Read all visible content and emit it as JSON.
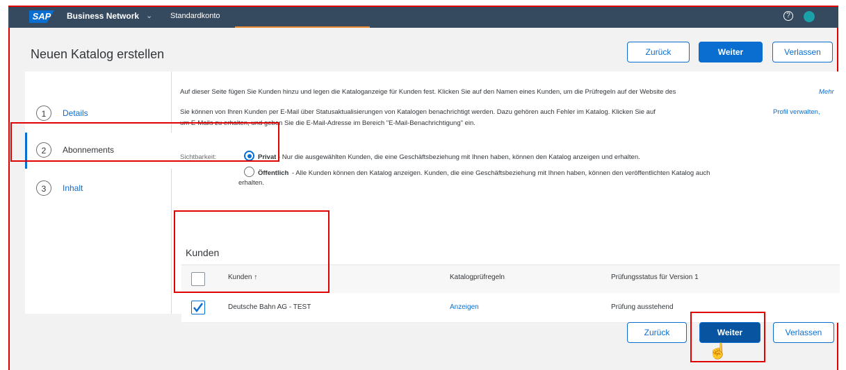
{
  "shell": {
    "logo": "SAP",
    "product": "Business Network",
    "account": "Standardkonto",
    "help_glyph": "?"
  },
  "header": {
    "title": "Neuen Katalog erstellen",
    "back_label": "Zurück",
    "next_label": "Weiter",
    "exit_label": "Verlassen"
  },
  "steps": [
    {
      "number": "1",
      "label": "Details"
    },
    {
      "number": "2",
      "label": "Abonnements"
    },
    {
      "number": "3",
      "label": "Inhalt"
    }
  ],
  "content": {
    "intro_1": "Auf dieser Seite fügen Sie Kunden hinzu und legen die Kataloganzeige für Kunden fest. Klicken Sie auf den Namen eines Kunden, um die Prüfregeln auf der Website des",
    "intro_1_more": "Mehr",
    "intro_2a": "Sie können von Ihren Kunden per E-Mail über Statusaktualisierungen von Katalogen benachrichtigt werden. Dazu gehören auch Fehler im Katalog. Klicken Sie auf",
    "intro_2_link": "Profil verwalten,",
    "intro_2b": "um E-Mails zu erhalten, und geben Sie die E-Mail-Adresse im Bereich \"E-Mail-Benachrichtigung\" ein.",
    "visibility_label": "Sichtbarkeit:",
    "private_label": "Privat",
    "private_desc": " - Nur die ausgewählten Kunden, die eine Geschäftsbeziehung mit Ihnen haben, können den Katalog anzeigen und erhalten.",
    "public_label": "Öffentlich",
    "public_desc": " - Alle Kunden können den Katalog anzeigen. Kunden, die eine Geschäftsbeziehung mit Ihnen haben, können den veröffentlichten Katalog auch",
    "public_desc_2": "erhalten."
  },
  "customers": {
    "title": "Kunden",
    "columns": [
      "Kunden",
      "Katalogprüfregeln",
      "Prüfungsstatus für Version 1"
    ],
    "sort_glyph": "↑",
    "rows": [
      {
        "name": "Deutsche Bahn AG - TEST",
        "rules": "Anzeigen",
        "status": "Prüfung ausstehend",
        "checked": true
      }
    ]
  },
  "footer": {
    "back_label": "Zurück",
    "next_label": "Weiter",
    "exit_label": "Verlassen"
  },
  "colors": {
    "shell": "#354a5f",
    "accent": "#0a6ed1",
    "annotation": "#e00000"
  }
}
